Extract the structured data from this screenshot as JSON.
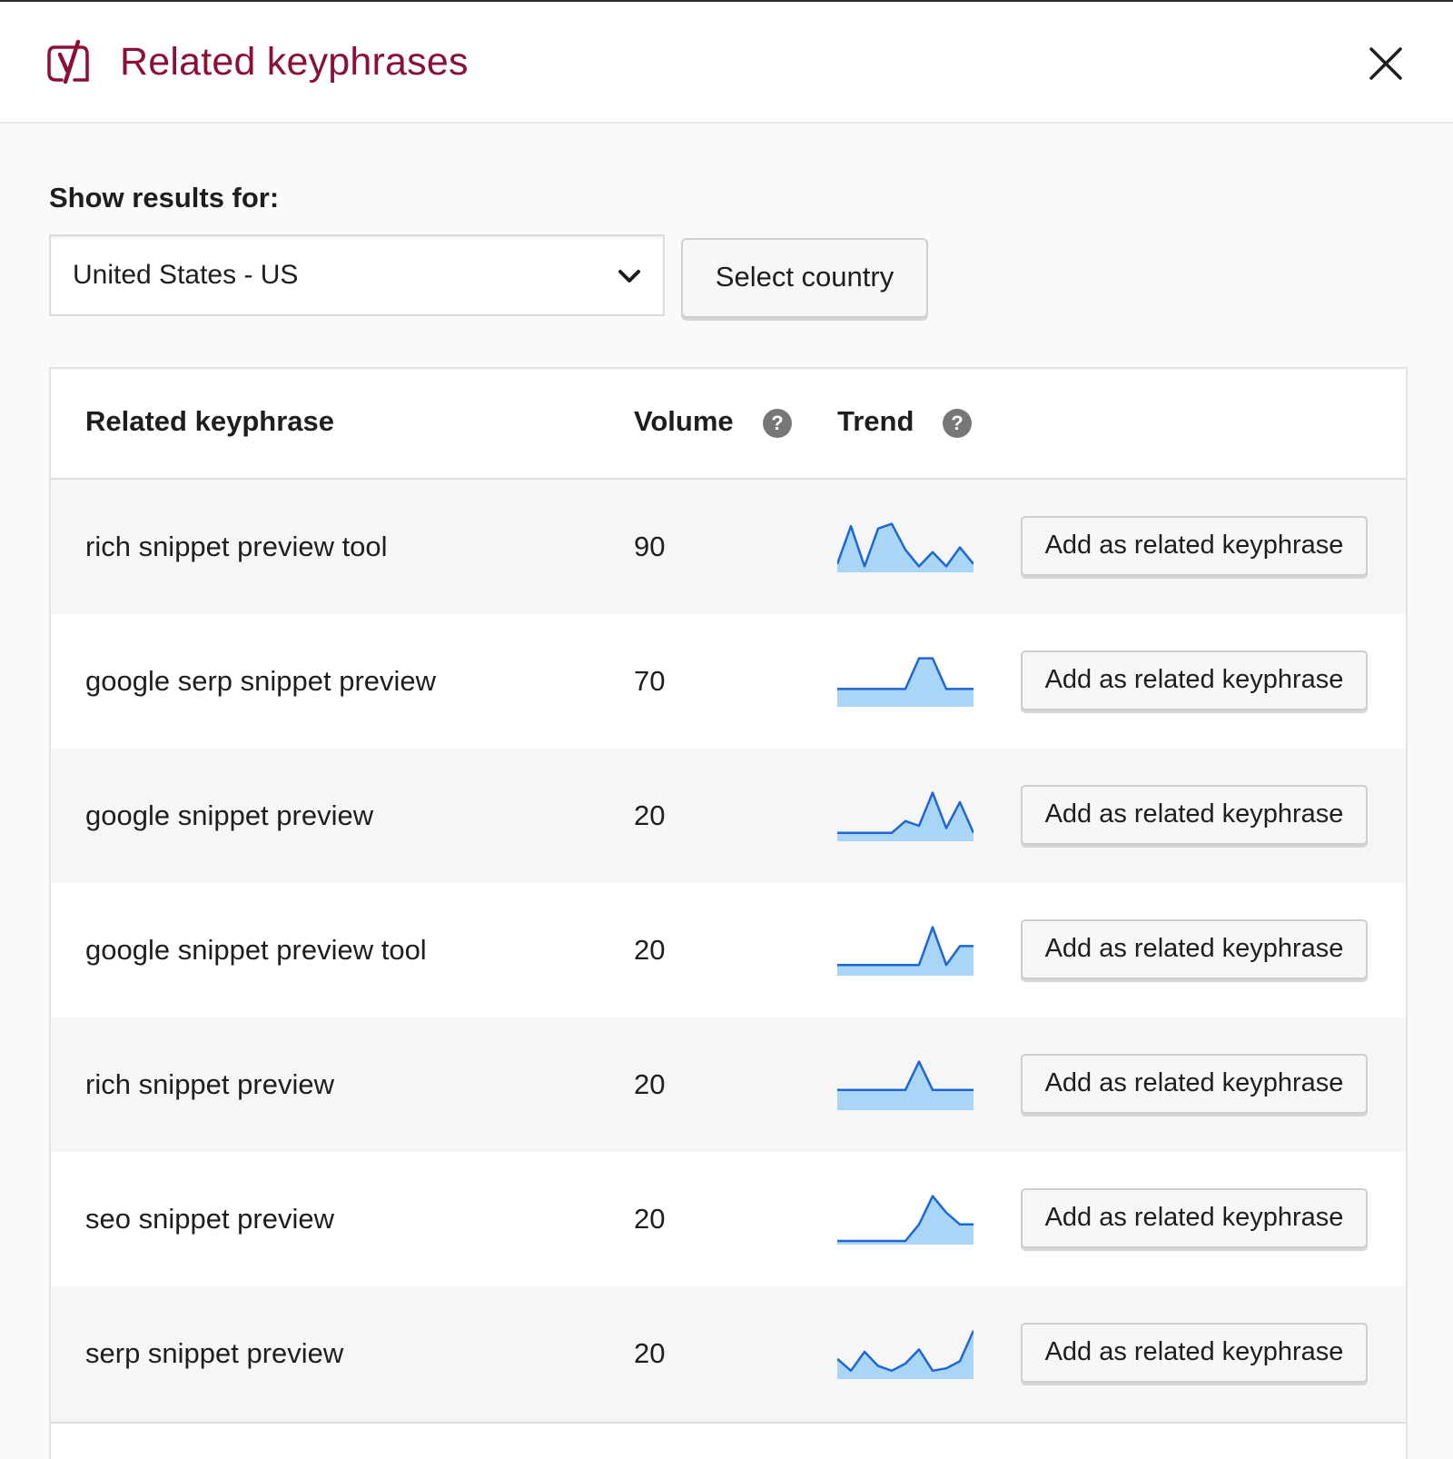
{
  "header": {
    "title": "Related keyphrases",
    "logo_icon": "yoast-logo-icon",
    "close_icon": "close-icon"
  },
  "filter": {
    "label": "Show results for:",
    "country_value": "United States - US",
    "select_button_label": "Select country"
  },
  "table": {
    "columns": {
      "keyphrase": "Related keyphrase",
      "volume": "Volume",
      "trend": "Trend",
      "help_icon_glyph": "?"
    },
    "add_button_label": "Add as related keyphrase",
    "trend_color": "#1e66d6",
    "trend_fill": "#a9d6f7",
    "rows": [
      {
        "keyphrase": "rich snippet preview tool",
        "volume": "90",
        "trend": [
          0.1,
          0.9,
          0.05,
          0.85,
          0.95,
          0.4,
          0.05,
          0.35,
          0.05,
          0.45,
          0.1
        ]
      },
      {
        "keyphrase": "google serp snippet preview",
        "volume": "70",
        "trend": [
          0.3,
          0.3,
          0.3,
          0.3,
          0.3,
          0.3,
          0.95,
          0.95,
          0.3,
          0.3,
          0.3
        ]
      },
      {
        "keyphrase": "google snippet preview",
        "volume": "20",
        "trend": [
          0.1,
          0.1,
          0.1,
          0.1,
          0.1,
          0.35,
          0.25,
          0.95,
          0.2,
          0.75,
          0.1
        ]
      },
      {
        "keyphrase": "google snippet preview tool",
        "volume": "20",
        "trend": [
          0.15,
          0.15,
          0.15,
          0.15,
          0.15,
          0.15,
          0.15,
          0.95,
          0.15,
          0.55,
          0.55
        ]
      },
      {
        "keyphrase": "rich snippet preview",
        "volume": "20",
        "trend": [
          0.35,
          0.35,
          0.35,
          0.35,
          0.35,
          0.35,
          0.95,
          0.35,
          0.35,
          0.35,
          0.35
        ]
      },
      {
        "keyphrase": "seo snippet preview",
        "volume": "20",
        "trend": [
          0.0,
          0.0,
          0.0,
          0.0,
          0.0,
          0.0,
          0.35,
          0.95,
          0.6,
          0.35,
          0.35
        ]
      },
      {
        "keyphrase": "serp snippet preview",
        "volume": "20",
        "trend": [
          0.35,
          0.1,
          0.5,
          0.2,
          0.1,
          0.25,
          0.55,
          0.1,
          0.15,
          0.3,
          0.95
        ]
      }
    ]
  }
}
